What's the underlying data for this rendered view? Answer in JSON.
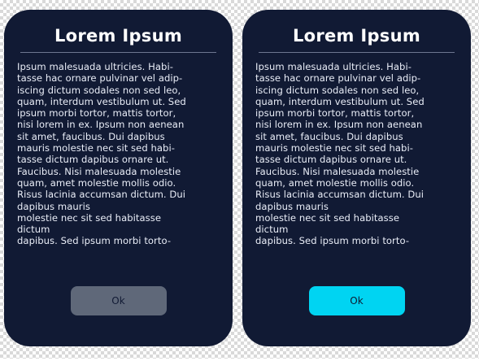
{
  "dialogs": [
    {
      "title": "Lorem Ipsum",
      "body": "Ipsum malesuada ultricies. Habi-\ntasse hac ornare pulvinar vel adip-\niscing dictum sodales non sed leo,\nquam, interdum vestibulum ut. Sed\nipsum morbi tortor, mattis tortor,\nnisi lorem in ex. Ipsum non aenean\nsit amet, faucibus. Dui dapibus\nmauris molestie nec sit sed habi-\ntasse dictum dapibus ornare ut.\nFaucibus. Nisi malesuada molestie\nquam, amet molestie mollis odio.\nRisus lacinia accumsan dictum. Dui\ndapibus mauris\nmolestie nec sit sed habitasse\ndictum\ndapibus. Sed ipsum morbi torto-",
      "button_label": "Ok",
      "button_state": "disabled"
    },
    {
      "title": "Lorem Ipsum",
      "body": "Ipsum malesuada ultricies. Habi-\ntasse hac ornare pulvinar vel adip-\niscing dictum sodales non sed leo,\nquam, interdum vestibulum ut. Sed\nipsum morbi tortor, mattis tortor,\nnisi lorem in ex. Ipsum non aenean\nsit amet, faucibus. Dui dapibus\nmauris molestie nec sit sed habi-\ntasse dictum dapibus ornare ut.\nFaucibus. Nisi malesuada molestie\nquam, amet molestie mollis odio.\nRisus lacinia accumsan dictum. Dui\ndapibus mauris\nmolestie nec sit sed habitasse\ndictum\ndapibus. Sed ipsum morbi torto-",
      "button_label": "Ok",
      "button_state": "active"
    }
  ],
  "colors": {
    "dialog_background": "#111a34",
    "button_disabled": "#5f6879",
    "button_active": "#00d4f2"
  }
}
